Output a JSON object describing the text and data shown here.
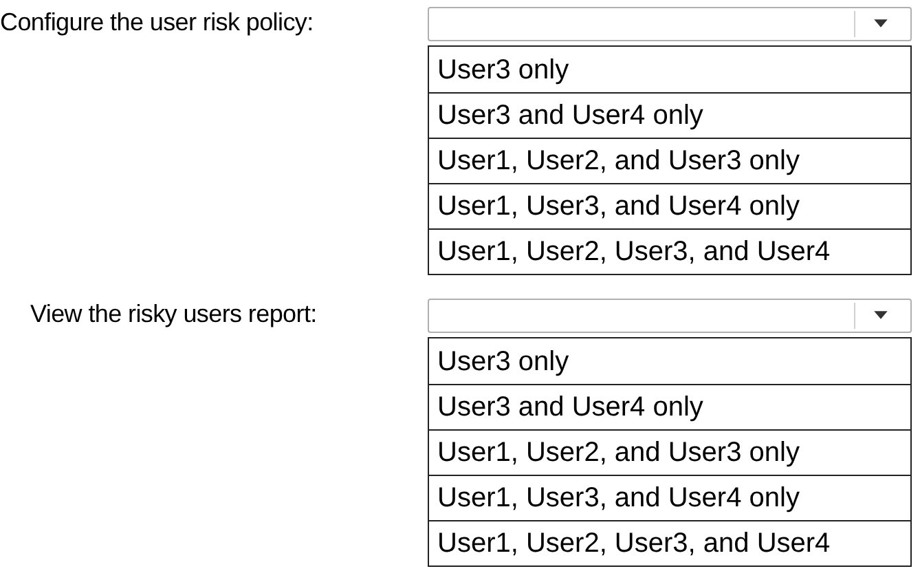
{
  "questions": [
    {
      "label": "Configure the user risk policy:",
      "options": [
        "User3 only",
        "User3 and User4 only",
        "User1, User2, and User3 only",
        "User1, User3, and User4 only",
        "User1, User2, User3, and User4"
      ]
    },
    {
      "label": "View the risky users report:",
      "options": [
        "User3 only",
        "User3 and User4 only",
        "User1, User2, and User3 only",
        "User1, User3, and User4 only",
        "User1, User2, User3, and User4"
      ]
    }
  ]
}
